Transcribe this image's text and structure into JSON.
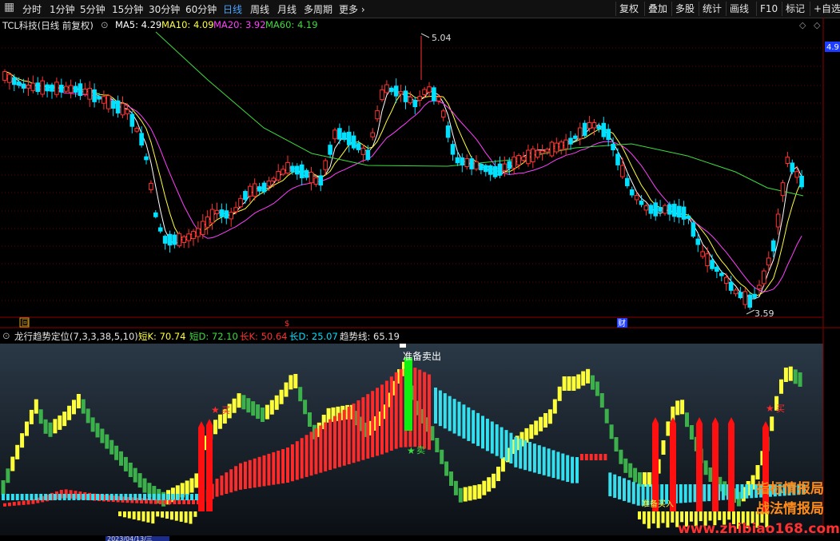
{
  "toolbar": {
    "periods": [
      "分时",
      "1分钟",
      "5分钟",
      "15分钟",
      "30分钟",
      "60分钟",
      "日线",
      "周线",
      "月线",
      "多周期",
      "更多"
    ],
    "active_period": "日线",
    "right_buttons": [
      "复权",
      "叠加",
      "多股",
      "统计",
      "画线",
      "F10",
      "标记",
      "+自选"
    ]
  },
  "main_chart": {
    "title": "TCL科技(日线 前复权)",
    "ma": [
      {
        "label": "MA5: 4.29",
        "color": "#ffffff"
      },
      {
        "label": "MA10: 4.09",
        "color": "#ffff3a"
      },
      {
        "label": "MA20: 3.92",
        "color": "#ff40ff"
      },
      {
        "label": "MA60: 4.19",
        "color": "#3cdc3c"
      }
    ],
    "high_label": "5.04",
    "low_label": "3.59",
    "price_tag": "4.9",
    "markers": {
      "left_box": "回",
      "mid": "$",
      "cai": "财"
    },
    "colors": {
      "up": "#ff3232",
      "down": "#00e0ff",
      "grid": "#6e0000"
    }
  },
  "indicator": {
    "title": "龙行趋势定位(7,3,3,38,5,10)",
    "values": [
      {
        "label": "短K: 70.74",
        "color": "#ffff3a"
      },
      {
        "label": "短D: 72.10",
        "color": "#3cdc3c"
      },
      {
        "label": "长K: 50.64",
        "color": "#ff3232"
      },
      {
        "label": "长D: 25.07",
        "color": "#00e0ff"
      },
      {
        "label": "趋势线: 65.19",
        "color": "#e6e6e6"
      }
    ],
    "annotations": {
      "ready_sell": "准备卖出",
      "sell": "卖",
      "buy": "买",
      "ready_buy": "准备买入"
    }
  },
  "watermarks": {
    "line1": "指标情报局",
    "line2": "战法情报局",
    "url": "www.zhibiao168.com"
  },
  "footer": {
    "date": "2023/04/13/三"
  }
}
